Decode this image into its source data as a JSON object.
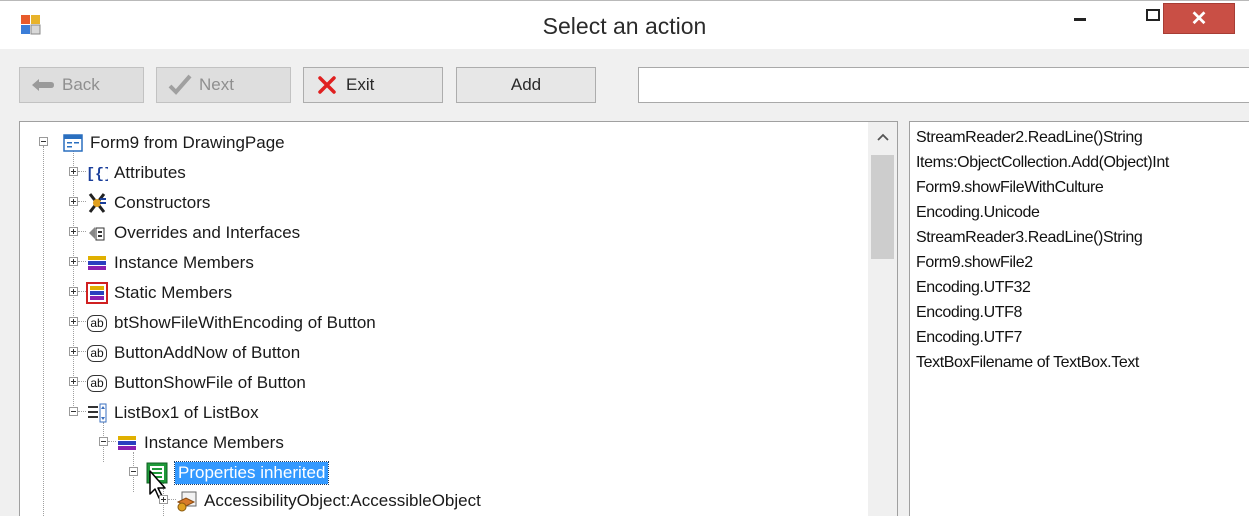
{
  "window": {
    "title": "Select an action"
  },
  "titlebar": {
    "close_glyph": "✕",
    "icons": {
      "app": "app-form-icon",
      "minimize": "minimize-icon",
      "maximize": "maximize-icon",
      "close": "close-icon"
    }
  },
  "toolbar": {
    "back_label": "Back",
    "next_label": "Next",
    "exit_label": "Exit",
    "add_label": "Add",
    "command_value": "",
    "icons": {
      "back": "back-hand-icon",
      "next": "checkmark-icon",
      "exit": "red-x-icon"
    }
  },
  "tree": {
    "root": {
      "label": "Form9 from DrawingPage",
      "icon": "form-icon",
      "expanded": true
    },
    "items": [
      {
        "label": "Attributes",
        "icon": "attributes-icon"
      },
      {
        "label": "Constructors",
        "icon": "constructors-icon"
      },
      {
        "label": "Overrides and Interfaces",
        "icon": "interfaces-icon"
      },
      {
        "label": "Instance Members",
        "icon": "members-stack-icon"
      },
      {
        "label": "Static Members",
        "icon": "static-members-icon"
      },
      {
        "label": "btShowFileWithEncoding of Button",
        "icon": "button-ab-icon"
      },
      {
        "label": "ButtonAddNow of Button",
        "icon": "button-ab-icon"
      },
      {
        "label": "ButtonShowFile of Button",
        "icon": "button-ab-icon"
      },
      {
        "label": "ListBox1 of ListBox",
        "icon": "listbox-icon",
        "expanded": true
      }
    ],
    "listbox_children": {
      "instance_members": {
        "label": "Instance Members",
        "icon": "members-stack-icon",
        "expanded": true
      },
      "properties_inherited": {
        "label": "Properties inherited",
        "icon": "properties-icon",
        "selected": true,
        "expanded": true
      },
      "accessibility_object": {
        "label": "AccessibilityObject:AccessibleObject",
        "icon": "property-object-icon"
      }
    }
  },
  "action_list": {
    "items": [
      "StreamReader2.ReadLine()String",
      "Items:ObjectCollection.Add(Object)Int",
      "Form9.showFileWithCulture",
      "Encoding.Unicode",
      "StreamReader3.ReadLine()String",
      "Form9.showFile2",
      "Encoding.UTF32",
      "Encoding.UTF8",
      "Encoding.UTF7",
      "TextBoxFilename of TextBox.Text"
    ]
  },
  "colors": {
    "selection": "#3399ff",
    "close_button": "#c94f45",
    "window_bg": "#f0f0f0"
  }
}
